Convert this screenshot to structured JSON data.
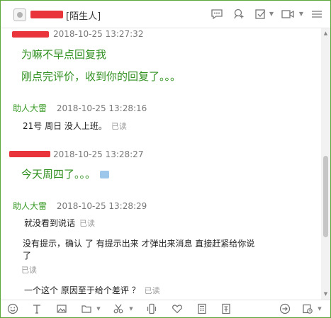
{
  "header": {
    "title_visible": "[陌生人]",
    "icons": [
      "chat-bubble-icon",
      "add-contact-icon",
      "checkbox-icon",
      "video-icon",
      "more-icon"
    ]
  },
  "messages": [
    {
      "nick": "",
      "time": "2018-10-25 13:27:32",
      "lines": [
        "为嘛不早点回复我",
        "刚点完评价，收到你的回复了。。。"
      ]
    },
    {
      "nick": "助人大雷",
      "time": "2018-10-25 13:28:16",
      "lines": [
        "21号 周日  没人上班。"
      ],
      "read": "已读"
    },
    {
      "nick": "",
      "time": "2018-10-25 13:28:27",
      "lines": [
        "今天周四了。。。"
      ]
    },
    {
      "nick": "助人大雷",
      "time": "2018-10-25 13:28:29",
      "lines": [
        "就没看到说话",
        "没有提示，确认 了 有提示出来 才弹出来消息 直接赶紧给你说",
        "了",
        "一个这个 原因至于给个差评 ？"
      ],
      "read": "已读"
    }
  ],
  "toolbar": {
    "icons": [
      "emoji-icon",
      "font-icon",
      "image-icon",
      "folder-icon",
      "scissors-icon",
      "phone-icon",
      "heart-icon",
      "calculator-icon",
      "document-icon",
      "reply-icon",
      "history-icon"
    ]
  },
  "colors": {
    "accent": "#5aa63a",
    "my_text": "#2f8f1f",
    "nick": "#3a9b27",
    "redaction": "#e8343a"
  }
}
